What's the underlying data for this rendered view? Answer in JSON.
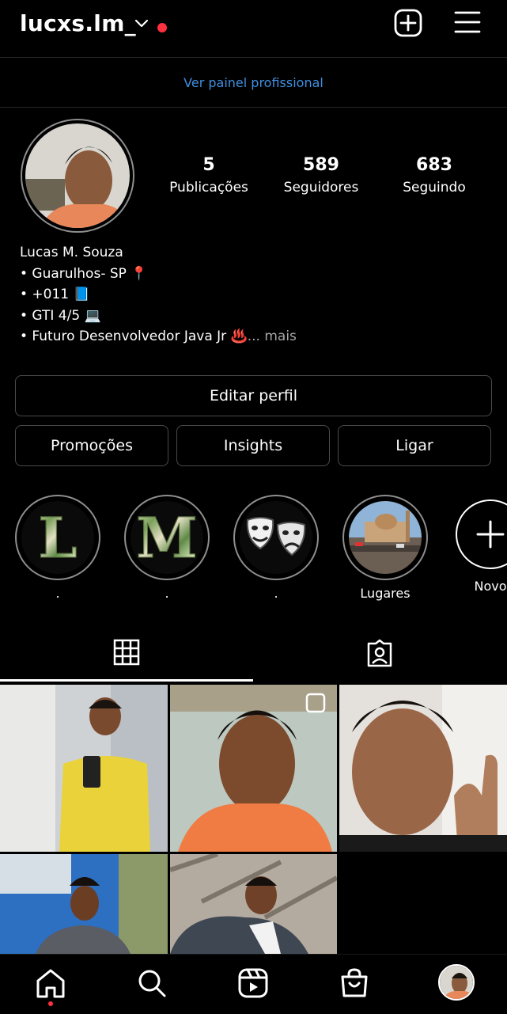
{
  "header": {
    "username": "lucxs.lm_",
    "pro_dashboard_link": "Ver painel profissional"
  },
  "profile": {
    "stats": [
      {
        "value": "5",
        "label": "Publicações"
      },
      {
        "value": "589",
        "label": "Seguidores"
      },
      {
        "value": "683",
        "label": "Seguindo"
      }
    ],
    "name": "Lucas M. Souza",
    "bio_lines": [
      "• Guarulhos- SP 📍",
      "• +011 📘",
      "• GTI 4/5 💻",
      "• Futuro Desenvolvedor Java Jr ♨️"
    ],
    "bio_more": "... mais"
  },
  "buttons": {
    "edit_profile": "Editar perfil",
    "promotions": "Promoções",
    "insights": "Insights",
    "call": "Ligar"
  },
  "highlights": [
    {
      "label": ".",
      "content": "L"
    },
    {
      "label": ".",
      "content": "M"
    },
    {
      "label": ".",
      "content": "theater-masks"
    },
    {
      "label": "Lugares",
      "content": "place-photo"
    },
    {
      "label": "Novo",
      "content": "plus-icon"
    }
  ],
  "tabs": [
    {
      "name": "posts-grid",
      "icon": "grid-icon",
      "active": true
    },
    {
      "name": "tagged",
      "icon": "tagged-icon",
      "active": false
    }
  ],
  "nav": [
    "home-icon",
    "search-icon",
    "reels-icon",
    "shop-icon",
    "profile-avatar"
  ],
  "colors": {
    "notification": "#ff3040",
    "link": "#3f8fe0",
    "background": "#000000"
  }
}
